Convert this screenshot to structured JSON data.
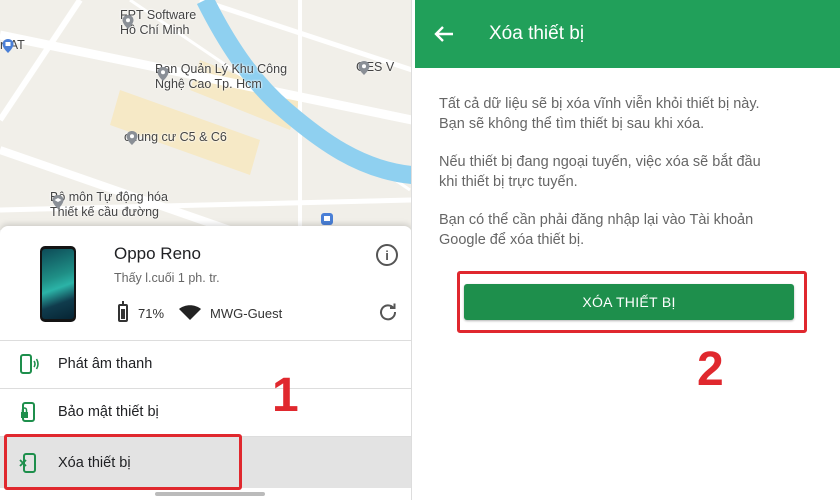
{
  "colors": {
    "brand_green": "#21a05a",
    "button_green": "#1e8f4c",
    "highlight_red": "#e0282e"
  },
  "map": {
    "labels": [
      {
        "id": "fpt",
        "text": "FPT Software\nHồ Chí Minh",
        "icon": "place-pin-icon"
      },
      {
        "id": "at",
        "text": "n AT",
        "icon": "transit-icon"
      },
      {
        "id": "bql",
        "text": "Ban Quản Lý Khu Công\nNghệ Cao Tp. Hcm",
        "icon": "place-pin-icon"
      },
      {
        "id": "ges",
        "text": "GES V",
        "icon": "place-pin-icon"
      },
      {
        "id": "c5c6",
        "text": "chung cư C5 & C6",
        "icon": "place-pin-icon"
      },
      {
        "id": "bomon",
        "text": "Bộ môn Tự động hóa\nThiết kế cầu đường",
        "icon": "school-icon"
      }
    ]
  },
  "device": {
    "name": "Oppo Reno",
    "last_seen": "Thấy l.cuối 1 ph. tr.",
    "battery": "71%",
    "network": "MWG-Guest"
  },
  "menu": [
    {
      "label": "Phát âm thanh",
      "icon": "play-sound-icon"
    },
    {
      "label": "Bảo mật thiết bị",
      "icon": "secure-device-icon"
    },
    {
      "label": "Xóa thiết bị",
      "icon": "erase-device-icon"
    }
  ],
  "wipe_screen": {
    "title": "Xóa thiết bị",
    "paragraphs": [
      "Tất cả dữ liệu sẽ bị xóa vĩnh viễn khỏi thiết bị này.\nBạn sẽ không thể tìm thiết bị sau khi xóa.",
      "Nếu thiết bị đang ngoại tuyến, việc xóa sẽ bắt đầu\nkhi thiết bị trực tuyến.",
      "Bạn có thể cần phải đăng nhập lại vào Tài khoản\nGoogle để xóa thiết bị."
    ],
    "button_label": "XÓA THIẾT BỊ"
  },
  "step_markers": [
    "1",
    "2"
  ]
}
